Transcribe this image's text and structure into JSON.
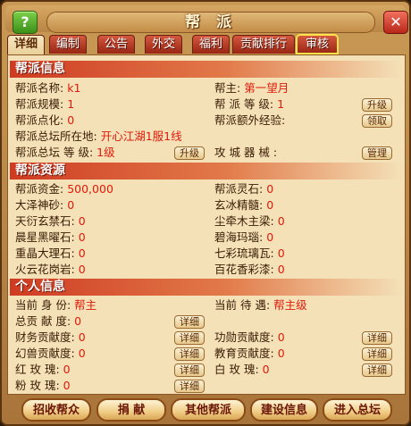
{
  "window": {
    "title": "帮 派",
    "help_label": "?",
    "close_label": "✕"
  },
  "tabs": [
    "详细",
    "编制",
    "公告",
    "外交",
    "福利",
    "贡献排行",
    "审核"
  ],
  "guild_info": {
    "header": "帮派信息",
    "name_label": "帮派名称:",
    "name_value": "k1",
    "leader_label": "帮主:",
    "leader_value": "第一望月",
    "scale_label": "帮派规模:",
    "scale_value": "1",
    "level_label": "帮 派 等 级:",
    "level_value": "1",
    "points_label": "帮派点化:",
    "points_value": "0",
    "extra_exp_label": "帮派额外经验:",
    "location_label": "帮派总坛所在地:",
    "location_value": "开心江湖1服1线",
    "hall_level_label": "帮派总坛 等 级:",
    "hall_level_value": "1级",
    "siege_label": "攻 城 器 械 :"
  },
  "resources": {
    "header": "帮派资源",
    "items": [
      {
        "label": "帮派资金:",
        "value": "500,000"
      },
      {
        "label": "帮派灵石:",
        "value": "0"
      },
      {
        "label": "大泽神砂:",
        "value": "0"
      },
      {
        "label": "玄冰精髓:",
        "value": "0"
      },
      {
        "label": "天衍玄禁石:",
        "value": "0"
      },
      {
        "label": "尘牵木主梁:",
        "value": "0"
      },
      {
        "label": "晨星黑曜石:",
        "value": "0"
      },
      {
        "label": "碧海玛瑙:",
        "value": "0"
      },
      {
        "label": "重晶大理石:",
        "value": "0"
      },
      {
        "label": "七彩琉璃瓦:",
        "value": "0"
      },
      {
        "label": "火云花岗岩:",
        "value": "0"
      },
      {
        "label": "百花香彩漆:",
        "value": "0"
      }
    ]
  },
  "personal": {
    "header": "个人信息",
    "identity_label": "当前 身 份:",
    "identity_value": "帮主",
    "treatment_label": "当前 待 遇:",
    "treatment_value": "帮主级",
    "total_label": "总贡 献 度:",
    "total_value": "0",
    "finance_label": "财务贡献度:",
    "finance_value": "0",
    "merit_label": "功勋贡献度:",
    "merit_value": "0",
    "beast_label": "幻兽贡献度:",
    "beast_value": "0",
    "edu_label": "教育贡献度:",
    "edu_value": "0",
    "red_label": "红  玫  瑰:",
    "red_value": "0",
    "white_label": "白  玫  瑰:",
    "white_value": "0",
    "pink_label": "粉  玫  瑰:",
    "pink_value": "0"
  },
  "buttons": {
    "upgrade": "升级",
    "claim": "领取",
    "manage": "管理",
    "detail": "详细"
  },
  "bottom": [
    "招收帮众",
    "捐  献",
    "其他帮派",
    "建设信息",
    "进入总坛"
  ]
}
